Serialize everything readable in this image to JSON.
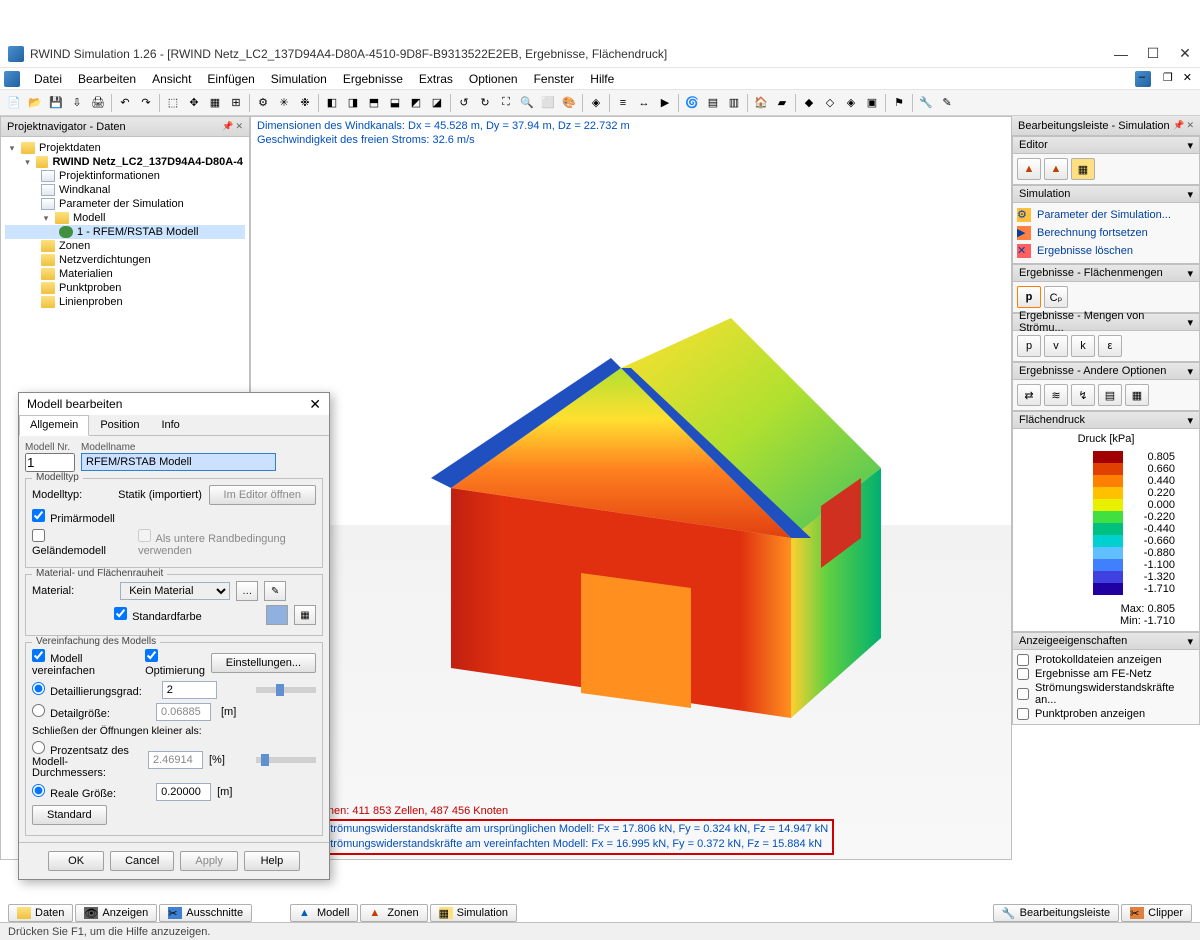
{
  "title": "RWIND Simulation 1.26 - [RWIND Netz_LC2_137D94A4-D80A-4510-9D8F-B9313522E2EB, Ergebnisse, Flächendruck]",
  "menu": [
    "Datei",
    "Bearbeiten",
    "Ansicht",
    "Einfügen",
    "Simulation",
    "Ergebnisse",
    "Extras",
    "Optionen",
    "Fenster",
    "Hilfe"
  ],
  "nav": {
    "header": "Projektnavigator - Daten",
    "root": "Projektdaten",
    "project": "RWIND Netz_LC2_137D94A4-D80A-4",
    "items": [
      "Projektinformationen",
      "Windkanal",
      "Parameter der Simulation"
    ],
    "model_node": "Modell",
    "model_child": "1 - RFEM/RSTAB Modell",
    "items2": [
      "Zonen",
      "Netzverdichtungen",
      "Materialien",
      "Punktproben",
      "Linienproben"
    ]
  },
  "viewport": {
    "dim": "Dimensionen des Windkanals: Dx = 45.528 m, Dy = 37.94 m, Dz = 22.732 m",
    "speed": "Geschwindigkeit des freien Stroms: 32.6 m/s",
    "mesh": "Netzinformationen: 411 853 Zellen, 487 456 Knoten",
    "sum1": "Summe der Strömungswiderstandskräfte am ursprünglichen Modell: Fx = 17.806 kN, Fy = 0.324 kN, Fz = 14.947 kN",
    "sum2": "Summe der Strömungswiderstandskräfte am vereinfachten Modell: Fx = 16.995 kN, Fy = 0.372 kN, Fz = 15.884 kN"
  },
  "right": {
    "header": "Bearbeitungsleiste - Simulation",
    "editor": "Editor",
    "simulation": "Simulation",
    "sim_links": [
      "Parameter der Simulation...",
      "Berechnung fortsetzen",
      "Ergebnisse löschen"
    ],
    "res_surf": "Ergebnisse - Flächenmengen",
    "res_flow": "Ergebnisse - Mengen von Strömu...",
    "res_other": "Ergebnisse - Andere Optionen",
    "pressure_header": "Flächendruck",
    "pressure_title": "Druck [kPa]",
    "legend": [
      {
        "c": "#a00000",
        "v": "0.805"
      },
      {
        "c": "#e04000",
        "v": "0.660"
      },
      {
        "c": "#ff8000",
        "v": "0.440"
      },
      {
        "c": "#ffc000",
        "v": "0.220"
      },
      {
        "c": "#e8f000",
        "v": "0.000"
      },
      {
        "c": "#40e040",
        "v": "-0.220"
      },
      {
        "c": "#00c080",
        "v": "-0.440"
      },
      {
        "c": "#00d0d0",
        "v": "-0.660"
      },
      {
        "c": "#60c0ff",
        "v": "-0.880"
      },
      {
        "c": "#4080ff",
        "v": "-1.100"
      },
      {
        "c": "#4040e0",
        "v": "-1.320"
      },
      {
        "c": "#2000a0",
        "v": "-1.710"
      }
    ],
    "max": "Max:    0.805",
    "min": "Min:   -1.710",
    "display_header": "Anzeigeeigenschaften",
    "display_items": [
      "Protokolldateien anzeigen",
      "Ergebnisse am FE-Netz",
      "Strömungswiderstandskräfte an...",
      "Punktproben anzeigen"
    ]
  },
  "dialog": {
    "title": "Modell bearbeiten",
    "tabs": [
      "Allgemein",
      "Position",
      "Info"
    ],
    "model_nr_label": "Modell Nr.",
    "model_name_label": "Modellname",
    "model_nr": "1",
    "model_name": "RFEM/RSTAB Modell",
    "modeltype_section": "Modelltyp",
    "modeltype_label": "Modelltyp:",
    "modeltype_value": "Statik (importiert)",
    "open_editor": "Im Editor öffnen",
    "primary": "Primärmodell",
    "terrain": "Geländemodell",
    "use_bc": "Als untere Randbedingung verwenden",
    "material_section": "Material- und Flächenrauheit",
    "material_label": "Material:",
    "material_value": "Kein Material",
    "default_color": "Standardfarbe",
    "simplify_section": "Vereinfachung des Modells",
    "simplify": "Modell vereinfachen",
    "optimize": "Optimierung",
    "settings": "Einstellungen...",
    "detail_grade": "Detaillierungsgrad:",
    "detail_grade_val": "2",
    "detail_size": "Detailgröße:",
    "detail_size_val": "0.06885",
    "unit_m": "[m]",
    "close_label": "Schließen der Öffnungen kleiner als:",
    "percent": "Prozentsatz des Modell-Durchmessers:",
    "percent_val": "2.46914",
    "unit_pct": "[%]",
    "real_size": "Reale Größe:",
    "real_size_val": "0.20000",
    "standard": "Standard",
    "ok": "OK",
    "cancel": "Cancel",
    "apply": "Apply",
    "help": "Help"
  },
  "bottom_tabs_left": [
    "Daten",
    "Anzeigen",
    "Ausschnitte"
  ],
  "bottom_tabs_mid": [
    "Modell",
    "Zonen",
    "Simulation"
  ],
  "bottom_tabs_right": [
    "Bearbeitungsleiste",
    "Clipper"
  ],
  "status": "Drücken Sie F1, um die Hilfe anzuzeigen."
}
